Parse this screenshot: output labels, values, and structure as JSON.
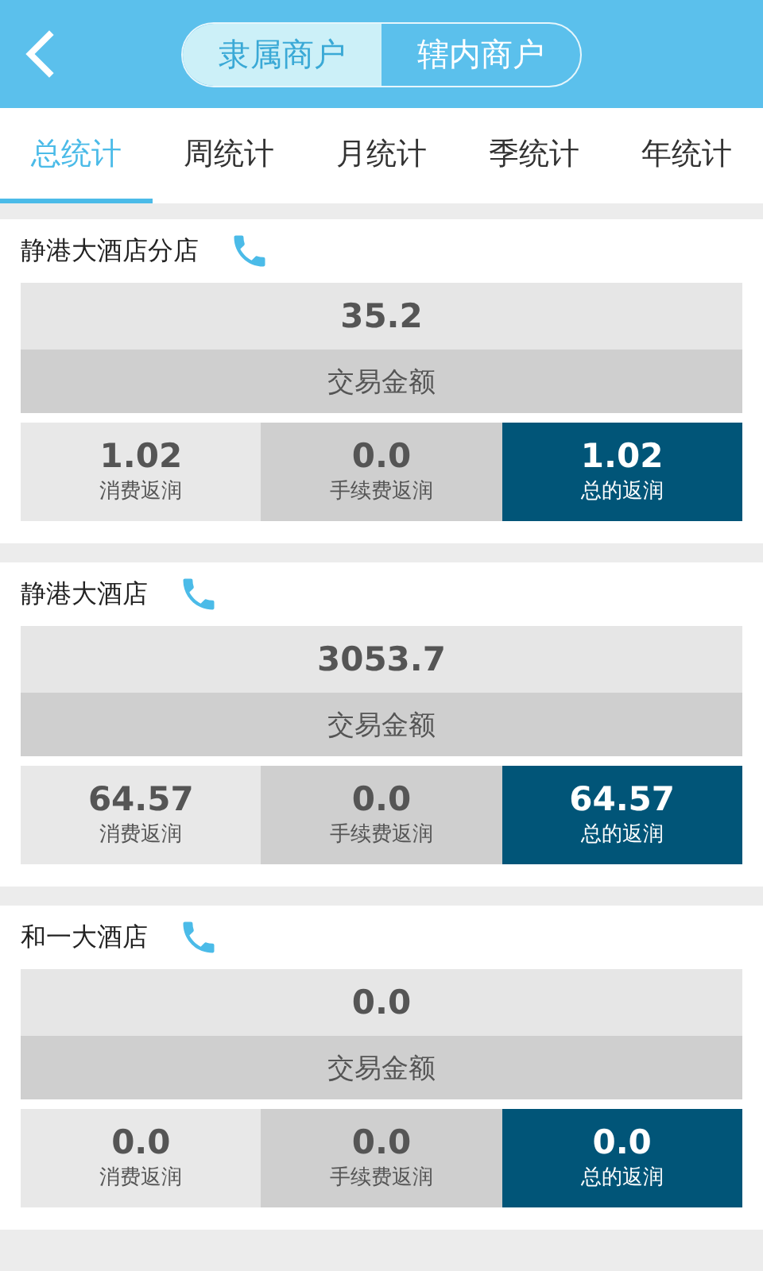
{
  "segments": [
    {
      "label": "隶属商户",
      "selected": true
    },
    {
      "label": "辖内商户",
      "selected": false
    }
  ],
  "tabs": [
    {
      "label": "总统计",
      "selected": true
    },
    {
      "label": "周统计",
      "selected": false
    },
    {
      "label": "月统计",
      "selected": false
    },
    {
      "label": "季统计",
      "selected": false
    },
    {
      "label": "年统计",
      "selected": false
    }
  ],
  "merchants": [
    {
      "name": "静港大酒店分店",
      "amount": "35.2",
      "amount_label": "交易金额",
      "stats": [
        {
          "kind": "light",
          "value": "1.02",
          "label": "消费返润"
        },
        {
          "kind": "mid",
          "value": "0.0",
          "label": "手续费返润"
        },
        {
          "kind": "dark",
          "value": "1.02",
          "label": "总的返润"
        }
      ]
    },
    {
      "name": "静港大酒店",
      "amount": "3053.7",
      "amount_label": "交易金额",
      "stats": [
        {
          "kind": "light",
          "value": "64.57",
          "label": "消费返润"
        },
        {
          "kind": "mid",
          "value": "0.0",
          "label": "手续费返润"
        },
        {
          "kind": "dark",
          "value": "64.57",
          "label": "总的返润"
        }
      ]
    },
    {
      "name": "和一大酒店",
      "amount": "0.0",
      "amount_label": "交易金额",
      "stats": [
        {
          "kind": "light",
          "value": "0.0",
          "label": "消费返润"
        },
        {
          "kind": "mid",
          "value": "0.0",
          "label": "手续费返润"
        },
        {
          "kind": "dark",
          "value": "0.0",
          "label": "总的返润"
        }
      ]
    }
  ]
}
